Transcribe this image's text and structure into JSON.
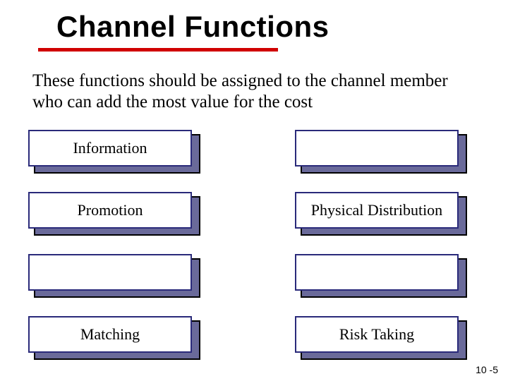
{
  "title": "Channel Functions",
  "subtitle": "These functions should be assigned to the channel member who can add the most value for the cost",
  "boxes": {
    "left": [
      "Information",
      "Promotion",
      "",
      "Matching"
    ],
    "right": [
      "",
      "Physical Distribution",
      "",
      "Risk Taking"
    ]
  },
  "page_number": "10 -5"
}
